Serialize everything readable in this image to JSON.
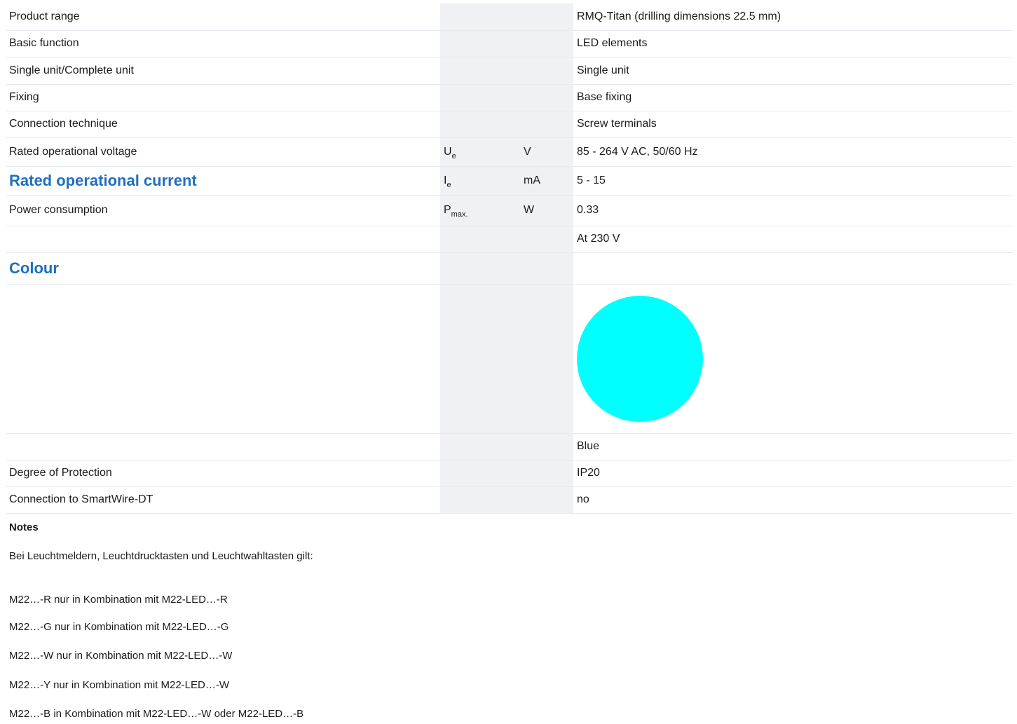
{
  "rows": [
    {
      "name": "Product range",
      "symbol": "",
      "symbol_sub": "",
      "unit": "",
      "value": "RMQ-Titan (drilling dimensions 22.5 mm)"
    },
    {
      "name": "Basic function",
      "symbol": "",
      "symbol_sub": "",
      "unit": "",
      "value": "LED elements"
    },
    {
      "name": "Single unit/Complete unit",
      "symbol": "",
      "symbol_sub": "",
      "unit": "",
      "value": "Single unit"
    },
    {
      "name": "Fixing",
      "symbol": "",
      "symbol_sub": "",
      "unit": "",
      "value": "Base fixing"
    },
    {
      "name": "Connection technique",
      "symbol": "",
      "symbol_sub": "",
      "unit": "",
      "value": "Screw terminals"
    },
    {
      "name": "Rated operational voltage",
      "symbol": "U",
      "symbol_sub": "e",
      "unit": "V",
      "value": "85 - 264 V AC, 50/60 Hz"
    },
    {
      "name": "Rated operational current",
      "symbol": "I",
      "symbol_sub": "e",
      "unit": "mA",
      "value": "5 - 15"
    },
    {
      "name": "Power consumption",
      "symbol": "P",
      "symbol_sub": "max.",
      "unit": "W",
      "value": "0.33"
    },
    {
      "name": "",
      "symbol": "",
      "symbol_sub": "",
      "unit": "",
      "value": "At 230 V"
    },
    {
      "name": "Colour",
      "symbol": "",
      "symbol_sub": "",
      "unit": "",
      "value": ""
    },
    {
      "name": "",
      "symbol": "",
      "symbol_sub": "",
      "unit": "",
      "value": ""
    },
    {
      "name": "",
      "symbol": "",
      "symbol_sub": "",
      "unit": "",
      "value": "Blue"
    },
    {
      "name": "Degree of Protection",
      "symbol": "",
      "symbol_sub": "",
      "unit": "",
      "value": "IP20"
    },
    {
      "name": "Connection to SmartWire-DT",
      "symbol": "",
      "symbol_sub": "",
      "unit": "",
      "value": "no"
    }
  ],
  "colors": {
    "heading": "#1e6fc1",
    "swatch": "#00ffff",
    "column_bg": "#f0f1f5"
  },
  "notes": {
    "title": "Notes",
    "intro": "Bei Leuchtmeldern, Leuchtdrucktasten und Leuchtwahltasten gilt:",
    "lines": [
      "M22…-R nur in Kombination mit M22-LED…-R",
      "M22…-G nur in Kombination mit M22-LED…-G",
      "M22…-W nur in Kombination mit M22-LED…-W",
      "M22…-Y nur in Kombination mit M22-LED…-W",
      "M22…-B in Kombination mit M22-LED…-W oder M22-LED…-B"
    ]
  }
}
